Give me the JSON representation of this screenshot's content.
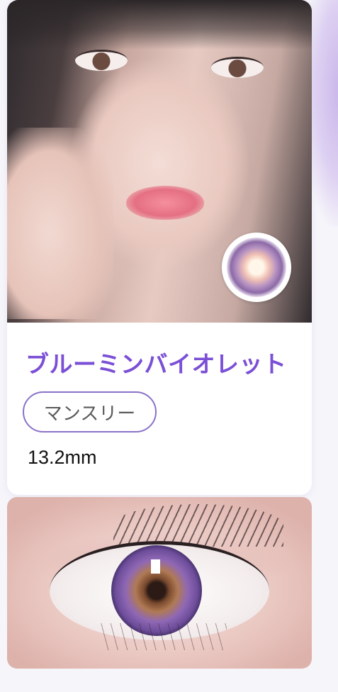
{
  "product": {
    "name": "ブルーミンバイオレット",
    "type_tag": "マンスリー",
    "diameter": "13.2mm"
  },
  "images": {
    "model_photo": "model-photo",
    "lens_thumbnail": "lens-swatch",
    "eye_closeup": "eye-closeup-photo"
  },
  "colors": {
    "accent_purple": "#7b4fd6",
    "tag_border": "#8a72c9",
    "card_bg": "#ffffff",
    "page_bg": "#f6f5fa"
  }
}
